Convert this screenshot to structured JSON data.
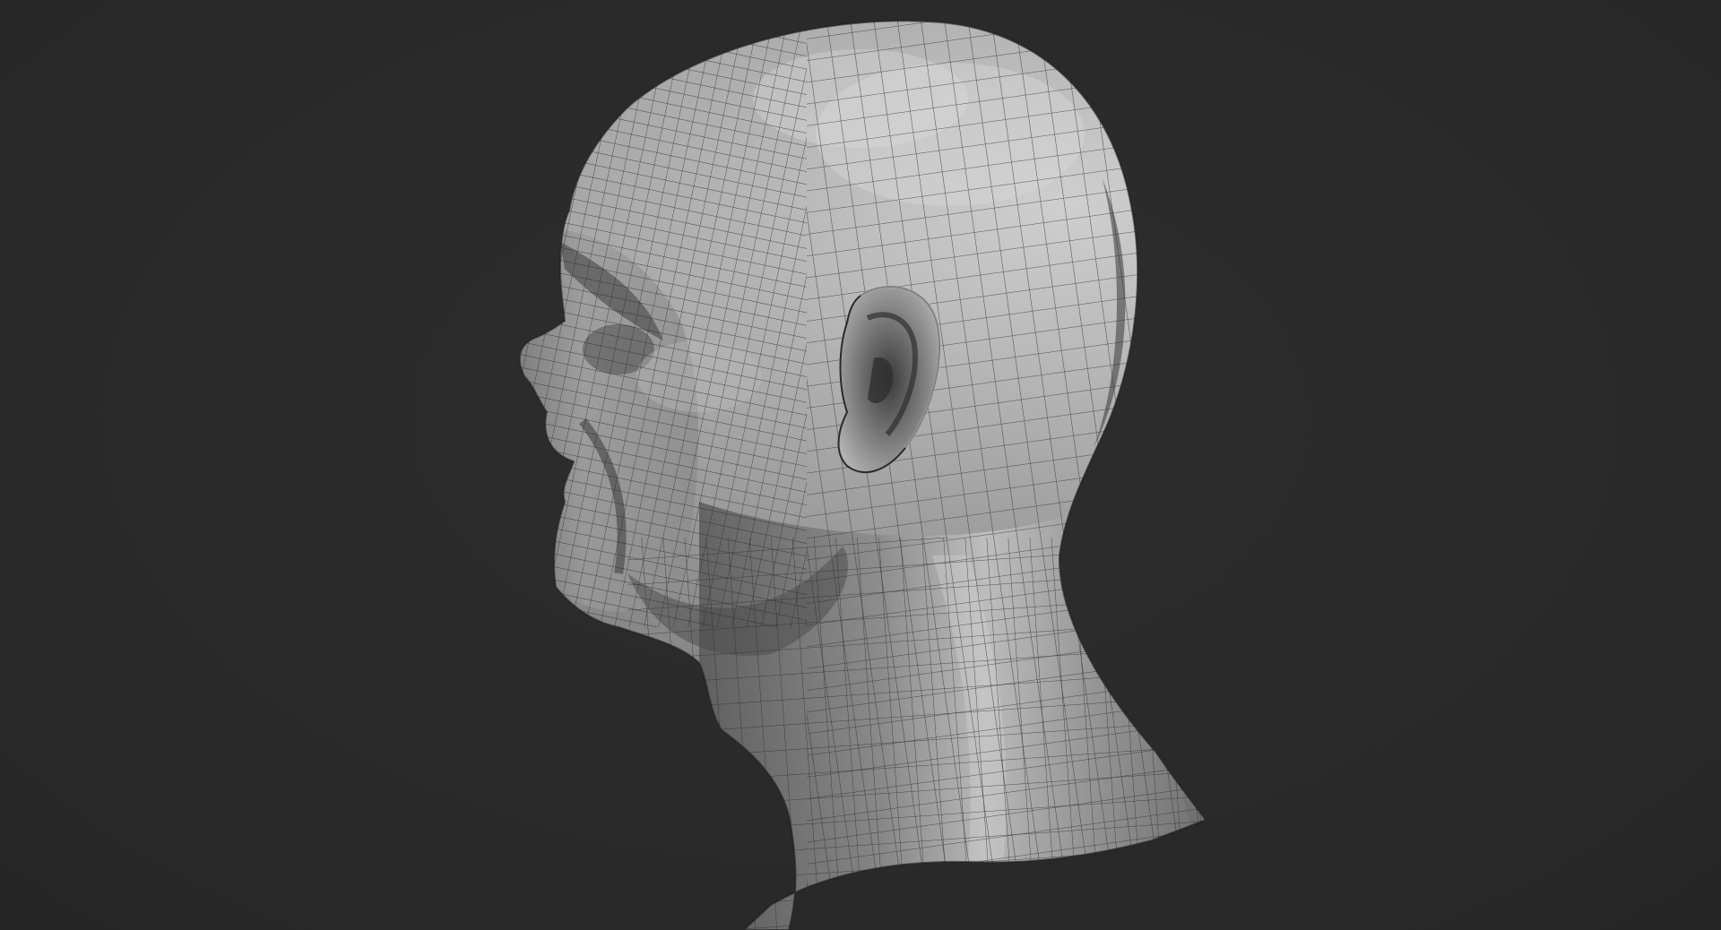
{
  "viewport": {
    "background_color": "#2a2a2a",
    "model": {
      "subject": "head-profile-mesh",
      "view": "left-side-profile",
      "display_mode": "shaded-wireframe",
      "surface_color": "#8f8f8f",
      "highlight_color": "#d2d2d2",
      "shadow_color": "#3c3c3c",
      "wire_color": "#2b2b2b"
    }
  }
}
